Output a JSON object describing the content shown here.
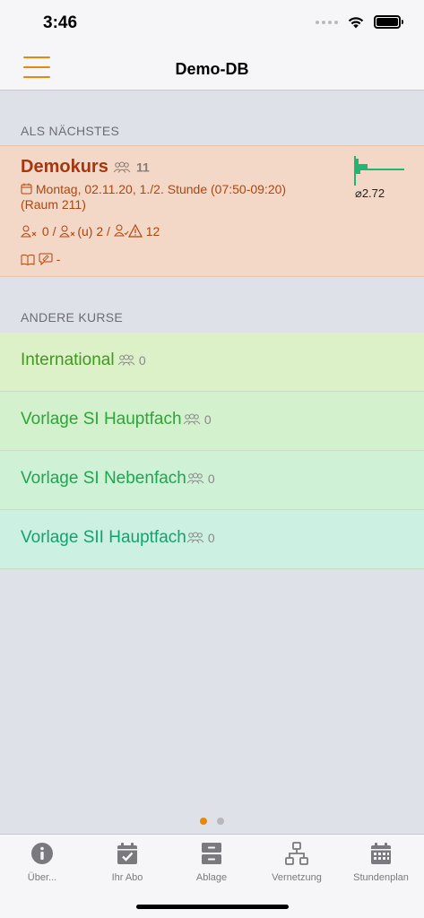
{
  "status_bar": {
    "time": "3:46"
  },
  "nav": {
    "title": "Demo-DB"
  },
  "next_section": {
    "header": "ALS NÄCHSTES",
    "course": {
      "title": "Demokurs",
      "students": "11",
      "schedule": "Montag, 02.11.20, 1./2. Stunde (07:50-09:20)",
      "room": "(Raum 211)",
      "absent": "0",
      "absent_excused": "2",
      "warnings": "12",
      "homework": "-",
      "grade_avg": "⌀2.72"
    }
  },
  "other_section": {
    "header": "ANDERE KURSE",
    "courses": [
      {
        "name": "International",
        "students": "0",
        "color": "#3f9a1c",
        "bg": "#dcf1c8"
      },
      {
        "name": "Vorlage SI Hauptfach",
        "students": "0",
        "color": "#2ea43a",
        "bg": "#d3f1cc"
      },
      {
        "name": "Vorlage SI Nebenfach",
        "students": "0",
        "color": "#1fa552",
        "bg": "#cff1d6"
      },
      {
        "name": "Vorlage SII Hauptfach",
        "students": "0",
        "color": "#12a270",
        "bg": "#ccf0e2"
      }
    ]
  },
  "pagination": {
    "active_color": "#e6890a",
    "inactive_color": "#b8b8bc"
  },
  "tabbar": {
    "tabs": [
      {
        "label": "Über...",
        "icon": "info-icon"
      },
      {
        "label": "Ihr Abo",
        "icon": "calendar-check-icon"
      },
      {
        "label": "Ablage",
        "icon": "archive-icon"
      },
      {
        "label": "Vernetzung",
        "icon": "network-icon"
      },
      {
        "label": "Stundenplan",
        "icon": "calendar-grid-icon"
      }
    ]
  },
  "colors": {
    "accent": "#e6890a",
    "next_course": "#a5360e",
    "grade_bar": "#22b573"
  }
}
